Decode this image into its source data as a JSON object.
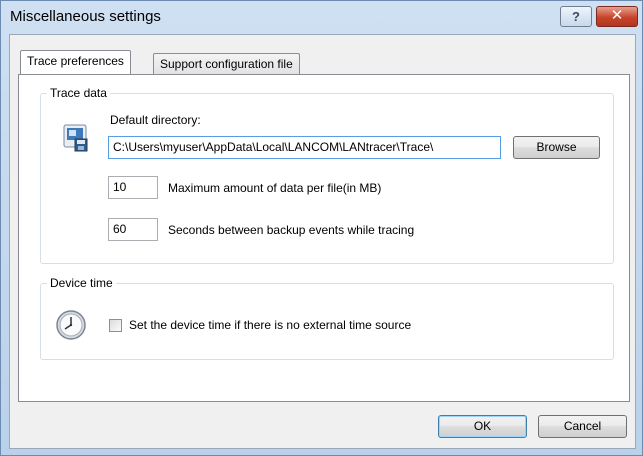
{
  "window": {
    "title": "Miscellaneous settings",
    "help_glyph": "?",
    "close_glyph": "✕"
  },
  "tabs": [
    {
      "label": "Trace preferences",
      "active": true
    },
    {
      "label": "Support configuration file",
      "active": false
    }
  ],
  "trace_data": {
    "legend": "Trace data",
    "icon": "folder-save-icon",
    "directory_label": "Default directory:",
    "directory_value": "C:\\Users\\myuser\\AppData\\Local\\LANCOM\\LANtracer\\Trace\\",
    "browse_label": "Browse",
    "max_data_value": "10",
    "max_data_label": "Maximum amount of data per file(in MB)",
    "backup_seconds_value": "60",
    "backup_seconds_label": "Seconds between backup events while tracing"
  },
  "device_time": {
    "legend": "Device time",
    "icon": "clock-icon",
    "checkbox_checked": false,
    "checkbox_label": "Set the device time if there is no external time source"
  },
  "footer": {
    "ok_label": "OK",
    "cancel_label": "Cancel"
  },
  "colors": {
    "title_bar": "#c4d9ef",
    "close_button": "#c6452b",
    "dialog_background": "#f0f0f0",
    "focus_border": "#569de5"
  }
}
